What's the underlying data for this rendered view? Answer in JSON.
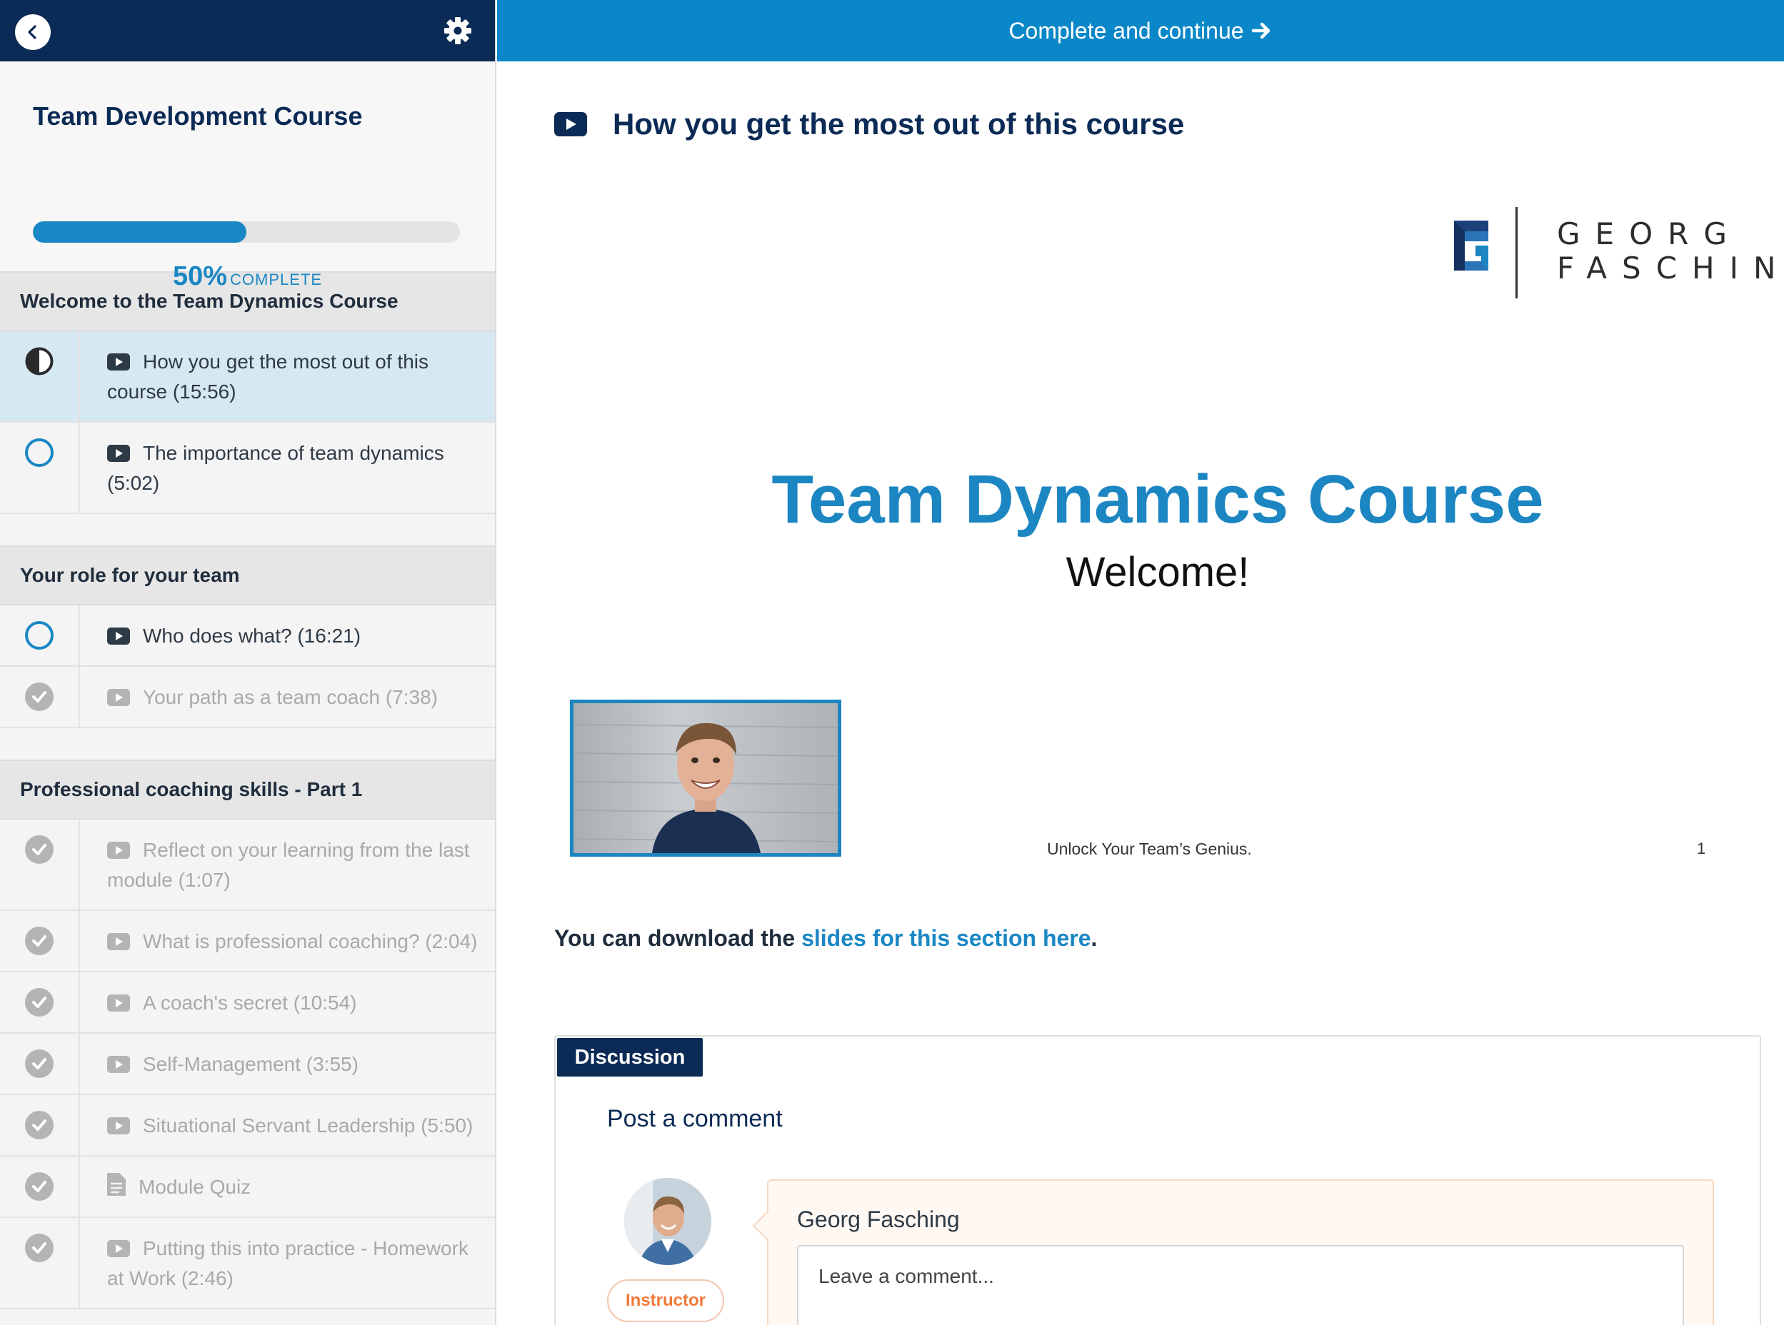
{
  "header": {
    "complete_label": "Complete and continue"
  },
  "course": {
    "title": "Team Development Course",
    "progress_fraction": 0.5,
    "progress_pct": "50%",
    "progress_label": "COMPLETE"
  },
  "sections": [
    {
      "title": "Welcome to the Team Dynamics Course",
      "lessons": [
        {
          "label": "How you get the most out of this course (15:56)",
          "type": "video",
          "status": "in-progress"
        },
        {
          "label": "The importance of team dynamics (5:02)",
          "type": "video",
          "status": "not-started"
        }
      ]
    },
    {
      "title": "Your role for your team",
      "lessons": [
        {
          "label": "Who does what? (16:21)",
          "type": "video",
          "status": "not-started"
        },
        {
          "label": "Your path as a team coach (7:38)",
          "type": "video",
          "status": "completed"
        }
      ]
    },
    {
      "title": "Professional coaching skills - Part 1",
      "lessons": [
        {
          "label": "Reflect on your learning from the last module (1:07)",
          "type": "video",
          "status": "completed"
        },
        {
          "label": "What is professional coaching? (2:04)",
          "type": "video",
          "status": "completed"
        },
        {
          "label": "A coach's secret (10:54)",
          "type": "video",
          "status": "completed"
        },
        {
          "label": "Self-Management (3:55)",
          "type": "video",
          "status": "completed"
        },
        {
          "label": "Situational Servant Leadership (5:50)",
          "type": "video",
          "status": "completed"
        },
        {
          "label": "Module Quiz",
          "type": "quiz",
          "status": "completed"
        },
        {
          "label": "Putting this into practice - Homework at Work (2:46)",
          "type": "video",
          "status": "completed"
        }
      ]
    }
  ],
  "lesson": {
    "title": "How you get the most out of this course"
  },
  "slide": {
    "logo_line1": "GEORG",
    "logo_line2": "FASCHING",
    "title": "Team Dynamics Course",
    "subtitle": "Welcome!",
    "footer": "Unlock Your Team’s Genius.",
    "page_number": "1"
  },
  "download": {
    "prefix": "You can download the ",
    "link": "slides for this section here",
    "suffix": "."
  },
  "discussion": {
    "tab_label": "Discussion",
    "post_title": "Post a comment",
    "user_name": "Georg Fasching",
    "role_badge": "Instructor",
    "comment_placeholder": "Leave a comment..."
  },
  "colors": {
    "navy": "#0b2a55",
    "accent_blue": "#1a87c4",
    "topbar_blue": "#0a87c8",
    "active_row": "#d6e8f2",
    "instructor_orange": "#f07a3a"
  },
  "icons": {
    "back": "chevron-left-icon",
    "settings": "gear-icon",
    "video": "video-play-icon",
    "quiz": "document-icon",
    "completed": "checkmark-circle-icon",
    "in_progress": "half-circle-icon",
    "not_started": "empty-circle-icon",
    "arrow": "arrow-right-icon"
  }
}
